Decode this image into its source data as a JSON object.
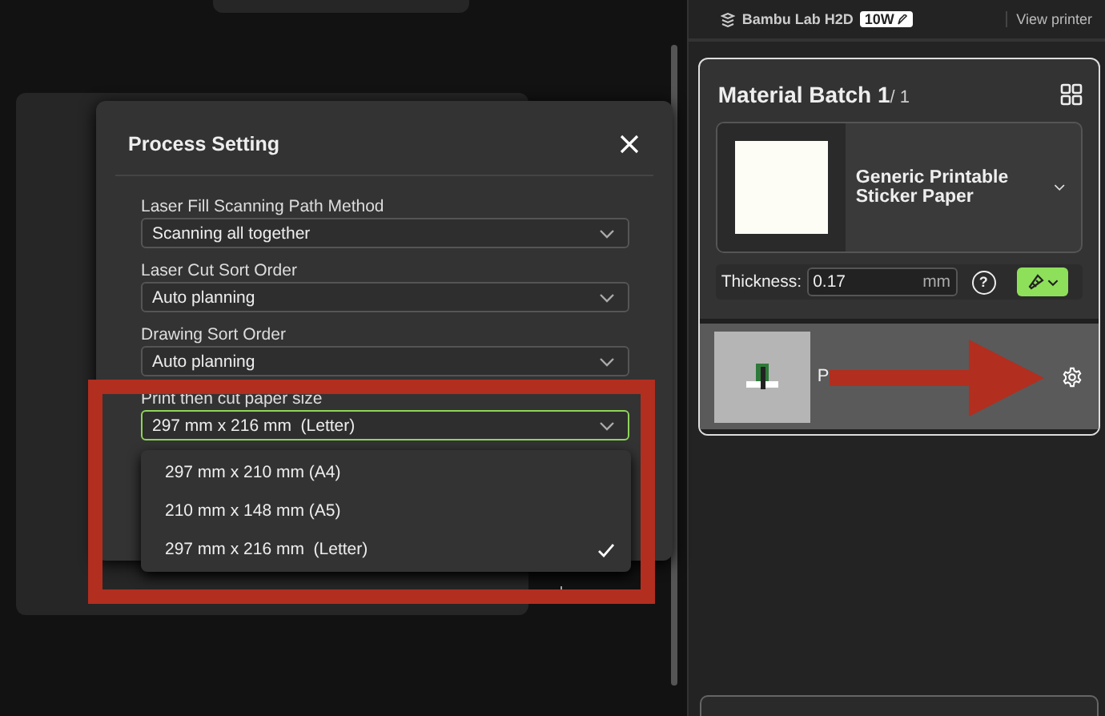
{
  "printer_bar": {
    "printer": "Bambu Lab H2D",
    "laser_power": "10W",
    "view_printer": "View printer"
  },
  "dialog": {
    "title": "Process Setting",
    "fields": [
      {
        "label": "Laser Fill Scanning Path Method",
        "value": "Scanning all together",
        "focused": false
      },
      {
        "label": "Laser Cut Sort Order",
        "value": "Auto planning",
        "focused": false
      },
      {
        "label": "Drawing Sort Order",
        "value": "Auto planning",
        "focused": false
      },
      {
        "label": "Print then cut paper size",
        "value": "297 mm x 216 mm  (Letter)",
        "focused": true
      }
    ],
    "options": [
      {
        "label": "297 mm x 210 mm (A4)",
        "selected": false
      },
      {
        "label": "210 mm x 148 mm (A5)",
        "selected": false
      },
      {
        "label": "297 mm x 216 mm  (Letter)",
        "selected": true
      }
    ]
  },
  "material_batch": {
    "title": "Material Batch 1",
    "count": "/ 1",
    "material": "Generic Printable Sticker Paper",
    "thickness_label": "Thickness:",
    "thickness": "0.17",
    "unit": "mm",
    "help": "?"
  },
  "plates": [
    {
      "name": "P"
    }
  ]
}
